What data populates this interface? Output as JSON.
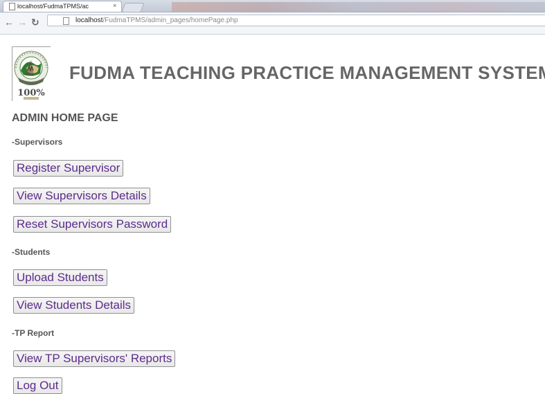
{
  "browser": {
    "tab_title": "localhost/FudmaTPMS/ac",
    "tab_close": "×",
    "url_host": "localhost",
    "url_path": "/FudmaTPMS/admin_pages/homePage.php",
    "icons": [
      "page-icon",
      "back-arrow-icon",
      "forward-arrow-icon",
      "reload-icon"
    ]
  },
  "header": {
    "logo_text": "100%",
    "site_title": "FUDMA TEACHING PRACTICE MANAGEMENT SYSTEM"
  },
  "page": {
    "heading": "ADMIN HOME PAGE",
    "sections": {
      "supervisors": {
        "label": "-Supervisors",
        "buttons": [
          "Register Supervisor",
          "View Supervisors Details",
          "Reset Supervisors Password"
        ]
      },
      "students": {
        "label": "-Students",
        "buttons": [
          "Upload Students",
          "View Students Details"
        ]
      },
      "tp_report": {
        "label": "-TP Report",
        "buttons": [
          "View TP Supervisors' Reports"
        ]
      }
    },
    "logout_label": "Log Out"
  },
  "colors": {
    "title_text": "#666666",
    "section_text": "#555555",
    "button_text": "#5c2c8c",
    "button_border": "#8f8f8f"
  }
}
